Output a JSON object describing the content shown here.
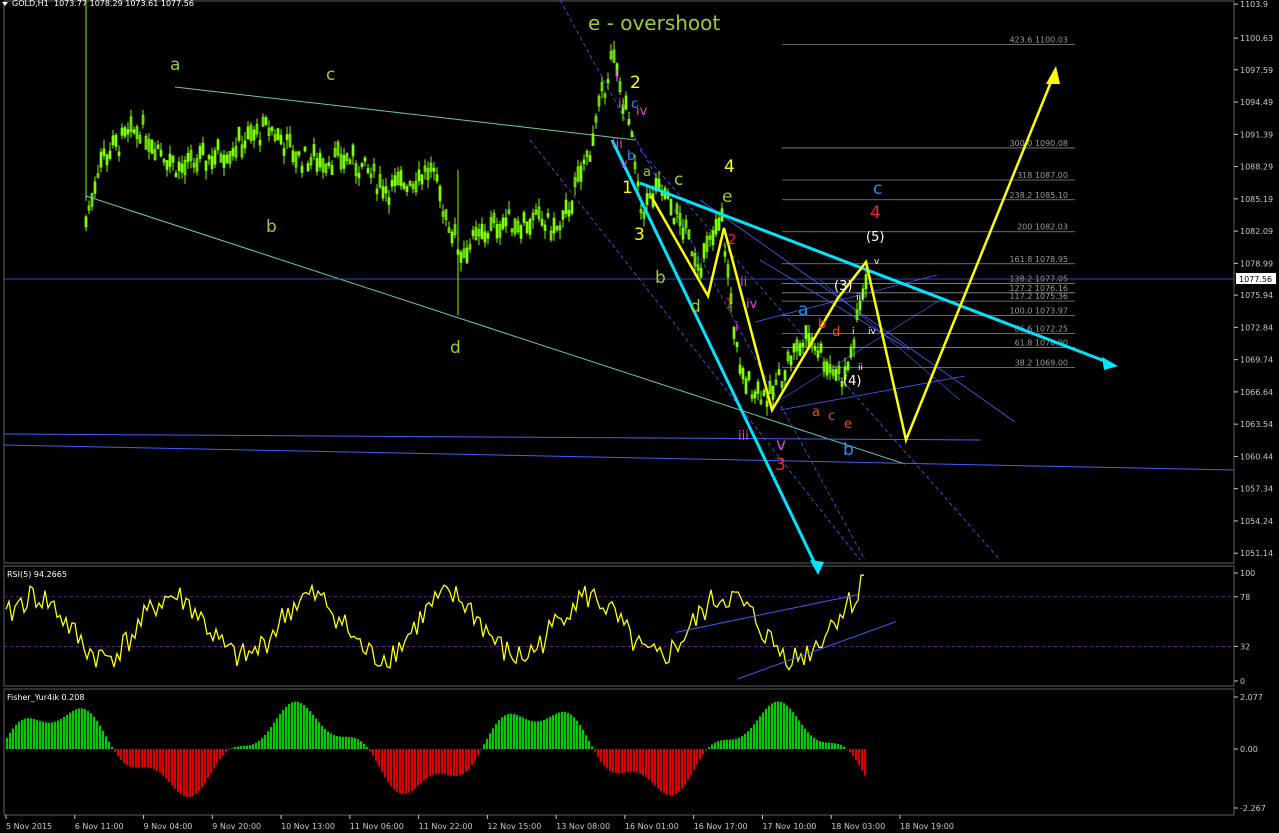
{
  "chart_data": [
    {
      "type": "candlestick",
      "title": "GOLD,H1",
      "ohlc_header": "1073.77 1078.29 1073.61 1077.56",
      "annotation_title": "e - overshoot",
      "current_price": "1077.56",
      "ylim": [
        1050.2,
        1104.2
      ],
      "y_ticks": [
        "1103.9",
        "1100.63",
        "1097.59",
        "1094.49",
        "1091.39",
        "1088.29",
        "1085.19",
        "1082.09",
        "1078.99",
        "1075.94",
        "1072.84",
        "1069.74",
        "1066.64",
        "1063.54",
        "1060.44",
        "1057.34",
        "1054.24",
        "1051.14"
      ],
      "x_labels": [
        "5 Nov 2015",
        "6 Nov 11:00",
        "9 Nov 04:00",
        "9 Nov 20:00",
        "10 Nov 13:00",
        "11 Nov 06:00",
        "11 Nov 22:00",
        "12 Nov 15:00",
        "13 Nov 08:00",
        "16 Nov 01:00",
        "16 Nov 17:00",
        "17 Nov 10:00",
        "18 Nov 03:00",
        "18 Nov 19:00"
      ],
      "fib_levels": [
        {
          "label": "423.6",
          "value": "1100.03"
        },
        {
          "label": "300.0",
          "value": "1090.08"
        },
        {
          "label": "318",
          "value": "1087.00"
        },
        {
          "label": "238.2",
          "value": "1085.10"
        },
        {
          "label": "200",
          "value": "1082.03"
        },
        {
          "label": "161.8",
          "value": "1078.95"
        },
        {
          "label": "138.2",
          "value": "1077.05"
        },
        {
          "label": "127.2",
          "value": "1076.16"
        },
        {
          "label": "117.2",
          "value": "1075.36"
        },
        {
          "label": "100.0",
          "value": "1073.97"
        },
        {
          "label": "86.6",
          "value": "1072.25"
        },
        {
          "label": "61.8",
          "value": "1070.90"
        },
        {
          "label": "38.2",
          "value": "1069.00"
        }
      ],
      "wave_labels": [
        {
          "text": "a",
          "color": "#9acd32"
        },
        {
          "text": "c",
          "color": "#9acd32"
        },
        {
          "text": "b",
          "color": "#9acd32"
        },
        {
          "text": "d",
          "color": "#9acd32"
        },
        {
          "text": "2",
          "color": "#ffff00"
        },
        {
          "text": "1",
          "color": "#ffff00"
        },
        {
          "text": "3",
          "color": "#ffff00"
        },
        {
          "text": "4",
          "color": "#ffff00"
        },
        {
          "text": "a",
          "color": "#9acd32"
        },
        {
          "text": "c",
          "color": "#9acd32"
        },
        {
          "text": "e",
          "color": "#9acd32"
        },
        {
          "text": "b",
          "color": "#9acd32"
        },
        {
          "text": "d",
          "color": "#9acd32"
        },
        {
          "text": "i",
          "color": "#e040e0"
        },
        {
          "text": "ii",
          "color": "#e040e0"
        },
        {
          "text": "iii",
          "color": "#e040e0"
        },
        {
          "text": "iv",
          "color": "#e040e0"
        },
        {
          "text": "v",
          "color": "#e040e0"
        },
        {
          "text": "c",
          "color": "#1e90ff"
        },
        {
          "text": "b",
          "color": "#1e90ff"
        },
        {
          "text": "1",
          "color": "#ff2020"
        },
        {
          "text": "2",
          "color": "#ff2020"
        },
        {
          "text": "3",
          "color": "#ff2020"
        },
        {
          "text": "4",
          "color": "#ff2020"
        },
        {
          "text": "i",
          "color": "#e040e0"
        },
        {
          "text": "ii",
          "color": "#e040e0"
        },
        {
          "text": "iv",
          "color": "#e040e0"
        },
        {
          "text": "iii",
          "color": "#e040e0"
        },
        {
          "text": "v",
          "color": "#e040e0"
        },
        {
          "text": "a",
          "color": "#1e90ff"
        },
        {
          "text": "b",
          "color": "#1e90ff"
        },
        {
          "text": "c",
          "color": "#1e90ff"
        },
        {
          "text": "a",
          "color": "#ff4500"
        },
        {
          "text": "b",
          "color": "#ff4500"
        },
        {
          "text": "c",
          "color": "#ff4500"
        },
        {
          "text": "d",
          "color": "#ff4500"
        },
        {
          "text": "e",
          "color": "#ff4500"
        },
        {
          "text": "(3)",
          "color": "#ffffff"
        },
        {
          "text": "(4)",
          "color": "#ffffff"
        },
        {
          "text": "(5)",
          "color": "#ffffff"
        },
        {
          "text": "i",
          "color": "#ffffff"
        },
        {
          "text": "ii",
          "color": "#ffffff"
        },
        {
          "text": "iii",
          "color": "#ffffff"
        },
        {
          "text": "iv",
          "color": "#ffffff"
        },
        {
          "text": "v",
          "color": "#ffffff"
        }
      ]
    },
    {
      "type": "line",
      "title": "RSI(5) 94.2665",
      "y_ticks": [
        "100",
        "78",
        "32",
        "0"
      ],
      "ylim": [
        0,
        100
      ],
      "levels": [
        78,
        32
      ]
    },
    {
      "type": "histogram",
      "title": "Fisher_Yur4ik 0.208",
      "y_ticks": [
        "2.077",
        "0.00",
        "-2.267"
      ],
      "ylim": [
        -2.267,
        2.077
      ]
    }
  ],
  "colors": {
    "background": "#000000",
    "candle": "#7fff00",
    "channel": "#66cdaa",
    "trend_cyan": "#00e5ff",
    "projection": "#ffff00",
    "grid_blue": "#4060ff",
    "rsi_line": "#ffff00",
    "hist_pos": "#00cc00",
    "hist_neg": "#dd0000",
    "fib_line": "#b0b0b0"
  }
}
